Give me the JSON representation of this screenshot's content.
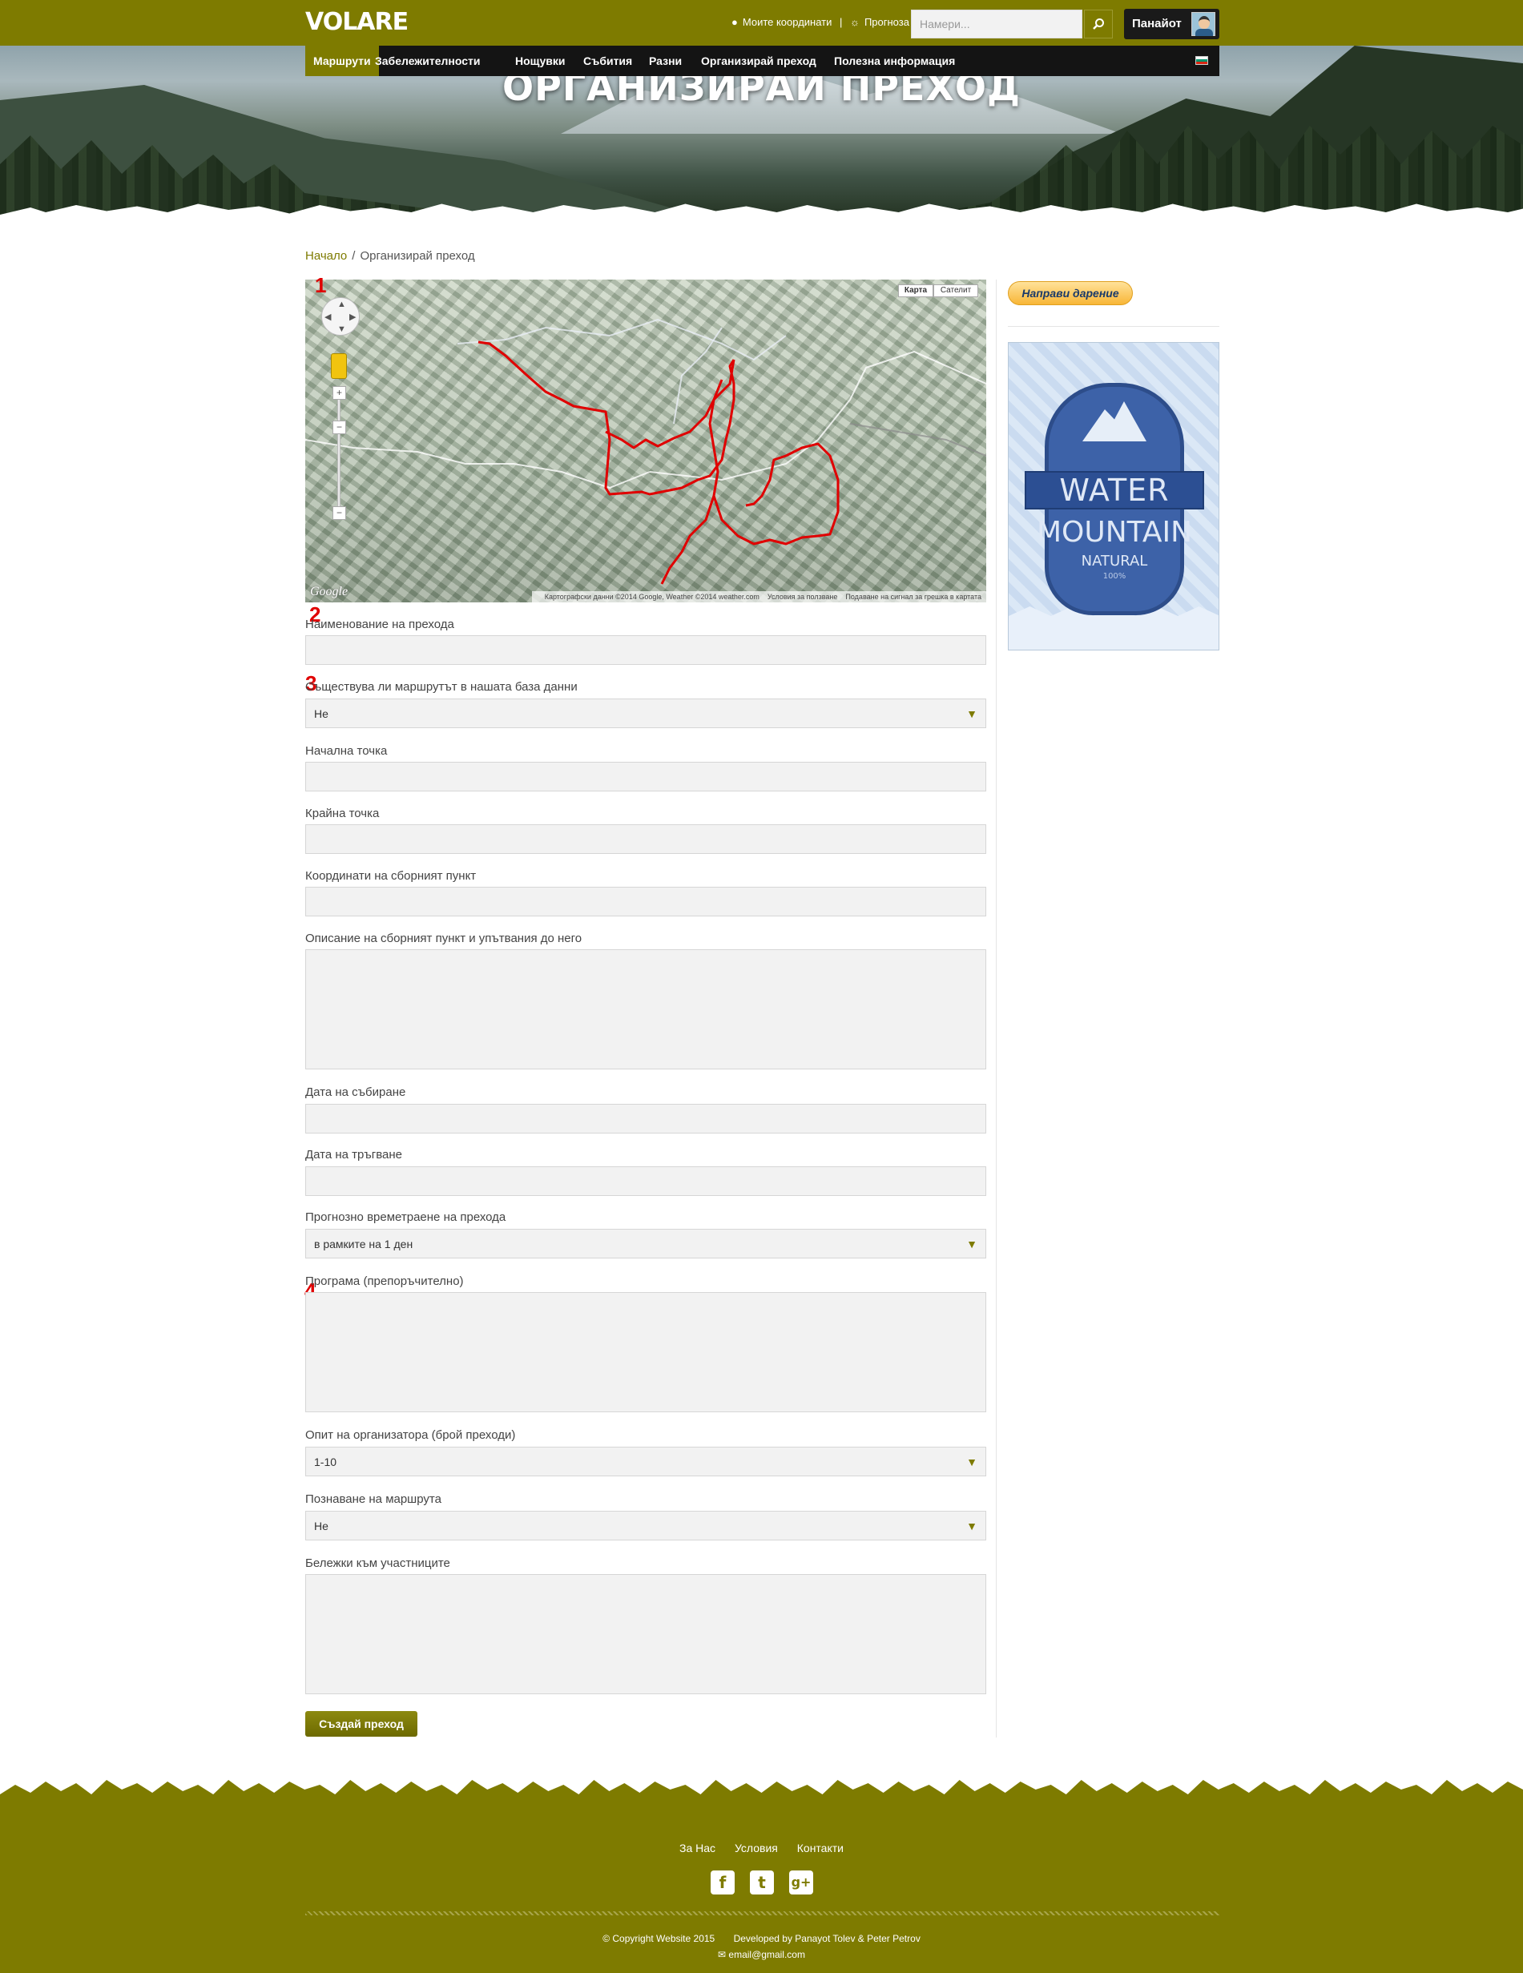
{
  "header": {
    "logo": "VOLARE",
    "my_coordinates": "Моите координати",
    "separator": "|",
    "forecast": "Прогноза",
    "search_placeholder": "Намери...",
    "user_name": "Панайот"
  },
  "nav": {
    "items": [
      {
        "label": "Маршрути",
        "active": true
      },
      {
        "label": "Забележителности",
        "active": false
      },
      {
        "label": "Нощувки",
        "active": false
      },
      {
        "label": "Събития",
        "active": false
      },
      {
        "label": "Разни",
        "active": false
      },
      {
        "label": "Организирай преход",
        "active": false
      },
      {
        "label": "Полезна информация",
        "active": false
      }
    ],
    "language_flag": "bg-flag-icon"
  },
  "hero": {
    "title": "ОРГАНИЗИРАЙ ПРЕХОД"
  },
  "breadcrumb": {
    "home": "Начало",
    "separator": "/",
    "current": "Организирай преход"
  },
  "map": {
    "type_map": "Карта",
    "type_satellite": "Сателит",
    "zoom_in": "+",
    "zoom_out": "−",
    "google_logo": "Google",
    "attribution": "Картографски данни ©2014 Google, Weather ©2014 weather.com",
    "terms": "Условия за ползване",
    "report": "Подаване на сигнал за грешка в картата",
    "route_color": "#e00000"
  },
  "annotations": [
    "1",
    "2",
    "3",
    "4"
  ],
  "form": {
    "name_label": "Наименование на прехода",
    "route_exists_label": "Съществува ли маршрутът в нашата база данни",
    "route_exists_value": "Не",
    "start_label": "Начална точка",
    "end_label": "Крайна точка",
    "meeting_coords_label": "Координати на сборният пункт",
    "meeting_desc_label": "Описание на сборният пункт и упътвания до него",
    "gather_date_label": "Дата на събиране",
    "depart_date_label": "Дата на тръгване",
    "duration_label": "Прогнозно времетраене на прехода",
    "duration_value": "в рамките на 1 ден",
    "program_label": "Програма (препоръчително)",
    "experience_label": "Опит на организатора (брой преходи)",
    "experience_value": "1-10",
    "familiarity_label": "Познаване на маршрута",
    "familiarity_value": "Не",
    "notes_label": "Бележки към участниците",
    "submit": "Създай преход"
  },
  "sidebar": {
    "donate": "Направи дарение",
    "ad": {
      "line1": "WATER",
      "line2": "MOUNTAIN",
      "line3": "NATURAL",
      "line4": "100%"
    }
  },
  "footer": {
    "links": [
      "За Нас",
      "Условия",
      "Контакти"
    ],
    "social": [
      {
        "icon": "facebook-icon",
        "glyph": "f"
      },
      {
        "icon": "twitter-icon",
        "glyph": "t"
      },
      {
        "icon": "google-plus-icon",
        "glyph": "g+"
      }
    ],
    "copyright": "© Copyright Website 2015",
    "developed_by": "Developed by Panayot Tolev & Peter Petrov",
    "email": "email@gmail.com"
  },
  "colors": {
    "brand": "#7e7b00",
    "nav_bg": "#141414",
    "route": "#e00000",
    "annotation": "#e00000"
  }
}
